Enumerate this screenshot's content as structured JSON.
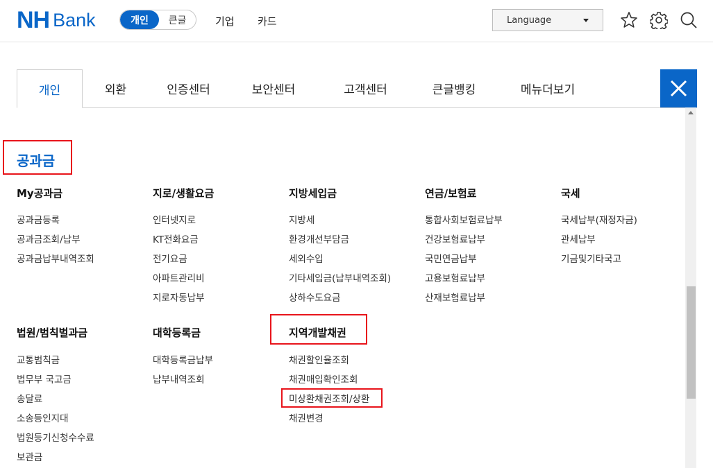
{
  "header": {
    "logo_nh": "NH",
    "logo_bank": "Bank",
    "segment": {
      "active": "개인",
      "inactive": "큰글"
    },
    "nav": [
      "기업",
      "카드"
    ],
    "language_label": "Language",
    "icons": [
      "star-icon",
      "gear-icon",
      "search-icon"
    ]
  },
  "tabs": [
    "개인",
    "외환",
    "인증센터",
    "보안센터",
    "고객센터",
    "큰글뱅킹",
    "메뉴더보기"
  ],
  "active_tab": "개인",
  "section_title": "공과금",
  "columns": {
    "my": {
      "title": "My공과금",
      "items": [
        "공과금등록",
        "공과금조회/납부",
        "공과금납부내역조회"
      ]
    },
    "giro": {
      "title": "지로/생활요금",
      "items": [
        "인터넷지로",
        "KT전화요금",
        "전기요금",
        "아파트관리비",
        "지로자동납부"
      ]
    },
    "local": {
      "title": "지방세입금",
      "items": [
        "지방세",
        "환경개선부담금",
        "세외수입",
        "기타세입금(납부내역조회)",
        "상하수도요금"
      ]
    },
    "pension": {
      "title": "연금/보험료",
      "items": [
        "통합사회보험료납부",
        "건강보험료납부",
        "국민연금납부",
        "고용보험료납부",
        "산재보험료납부"
      ]
    },
    "national": {
      "title": "국세",
      "items": [
        "국세납부(재정자금)",
        "관세납부",
        "기금및기타국고"
      ]
    },
    "court": {
      "title": "법원/범칙벌과금",
      "items": [
        "교통범칙금",
        "법무부 국고금",
        "송달료",
        "소송등인지대",
        "법원등기신청수수료",
        "보관금"
      ]
    },
    "tuition": {
      "title": "대학등록금",
      "items": [
        "대학등록금납부",
        "납부내역조회"
      ]
    },
    "bond": {
      "title": "지역개발채권",
      "items": [
        "채권할인율조회",
        "채권매입확인조회",
        "미상환채권조회/상환",
        "채권변경"
      ]
    }
  },
  "colors": {
    "brand": "#0a66c8",
    "highlight": "#e8141b"
  }
}
